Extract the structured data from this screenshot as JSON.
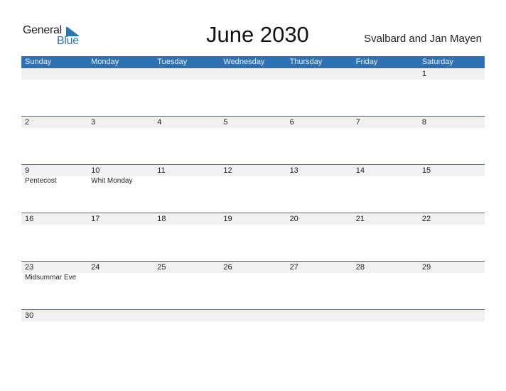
{
  "logo": {
    "word1": "General",
    "word2": "Blue"
  },
  "header": {
    "title": "June 2030",
    "region": "Svalbard and Jan Mayen"
  },
  "colors": {
    "accent": "#2f72b3",
    "strip": "#f0f0f0"
  },
  "days": [
    "Sunday",
    "Monday",
    "Tuesday",
    "Wednesday",
    "Thursday",
    "Friday",
    "Saturday"
  ],
  "weeks": [
    [
      {
        "d": "",
        "e": ""
      },
      {
        "d": "",
        "e": ""
      },
      {
        "d": "",
        "e": ""
      },
      {
        "d": "",
        "e": ""
      },
      {
        "d": "",
        "e": ""
      },
      {
        "d": "",
        "e": ""
      },
      {
        "d": "1",
        "e": ""
      }
    ],
    [
      {
        "d": "2",
        "e": ""
      },
      {
        "d": "3",
        "e": ""
      },
      {
        "d": "4",
        "e": ""
      },
      {
        "d": "5",
        "e": ""
      },
      {
        "d": "6",
        "e": ""
      },
      {
        "d": "7",
        "e": ""
      },
      {
        "d": "8",
        "e": ""
      }
    ],
    [
      {
        "d": "9",
        "e": "Pentecost"
      },
      {
        "d": "10",
        "e": "Whit Monday"
      },
      {
        "d": "11",
        "e": ""
      },
      {
        "d": "12",
        "e": ""
      },
      {
        "d": "13",
        "e": ""
      },
      {
        "d": "14",
        "e": ""
      },
      {
        "d": "15",
        "e": ""
      }
    ],
    [
      {
        "d": "16",
        "e": ""
      },
      {
        "d": "17",
        "e": ""
      },
      {
        "d": "18",
        "e": ""
      },
      {
        "d": "19",
        "e": ""
      },
      {
        "d": "20",
        "e": ""
      },
      {
        "d": "21",
        "e": ""
      },
      {
        "d": "22",
        "e": ""
      }
    ],
    [
      {
        "d": "23",
        "e": "Midsummar Eve"
      },
      {
        "d": "24",
        "e": ""
      },
      {
        "d": "25",
        "e": ""
      },
      {
        "d": "26",
        "e": ""
      },
      {
        "d": "27",
        "e": ""
      },
      {
        "d": "28",
        "e": ""
      },
      {
        "d": "29",
        "e": ""
      }
    ],
    [
      {
        "d": "30",
        "e": ""
      },
      {
        "d": "",
        "e": ""
      },
      {
        "d": "",
        "e": ""
      },
      {
        "d": "",
        "e": ""
      },
      {
        "d": "",
        "e": ""
      },
      {
        "d": "",
        "e": ""
      },
      {
        "d": "",
        "e": ""
      }
    ]
  ]
}
